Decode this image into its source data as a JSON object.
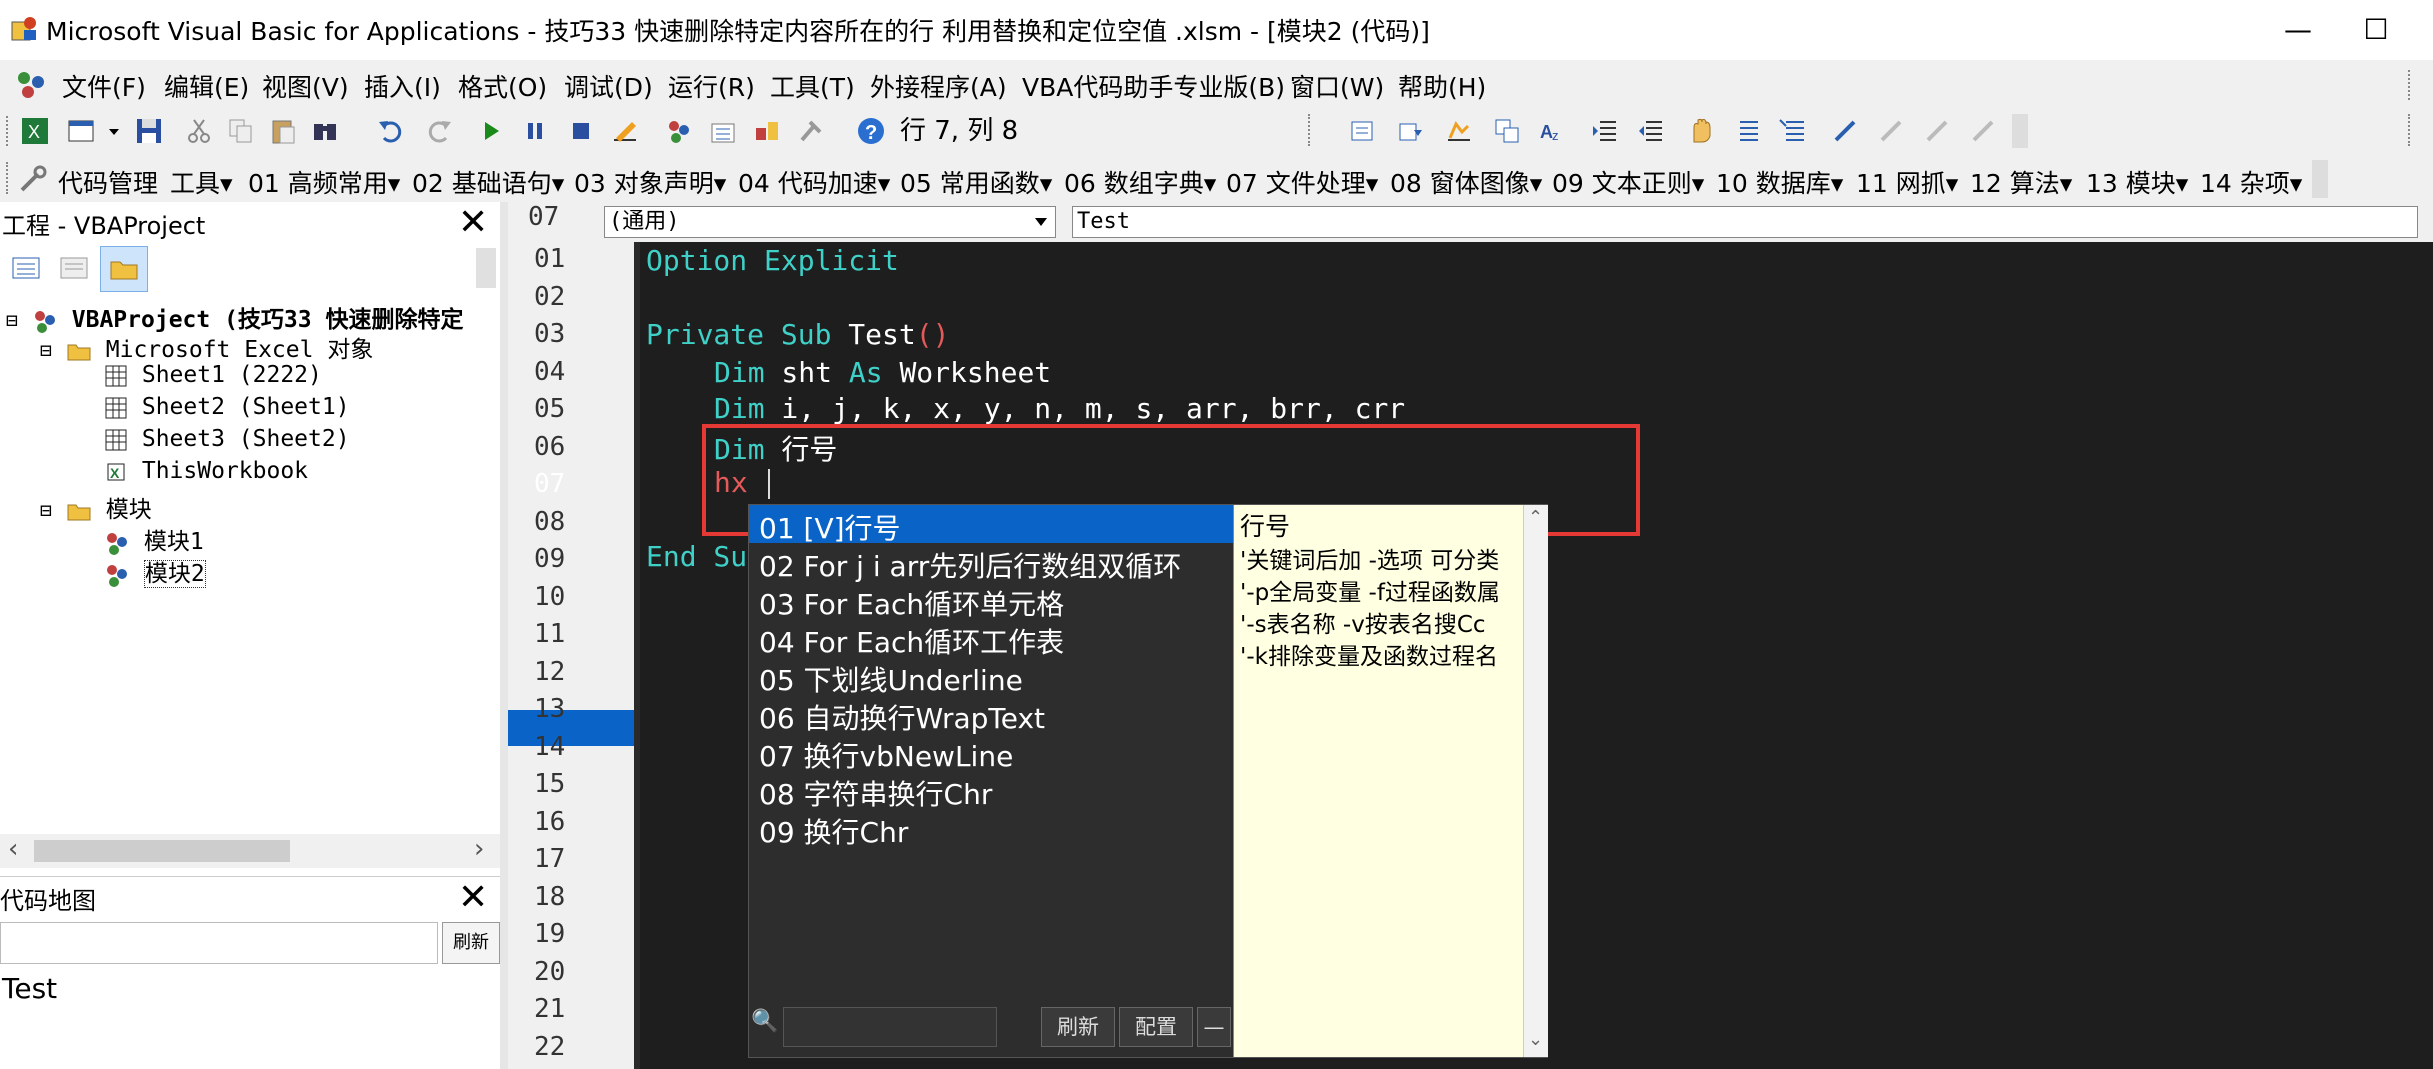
{
  "window": {
    "title": "Microsoft Visual Basic for Applications - 技巧33 快速删除特定内容所在的行 利用替换和定位空值 .xlsm - [模块2 (代码)]",
    "minimize_glyph": "—",
    "maximize_glyph": "☐"
  },
  "menu": [
    {
      "label": "文件(F)"
    },
    {
      "label": "编辑(E)"
    },
    {
      "label": "视图(V)"
    },
    {
      "label": "插入(I)"
    },
    {
      "label": "格式(O)"
    },
    {
      "label": "调试(D)"
    },
    {
      "label": "运行(R)"
    },
    {
      "label": "工具(T)"
    },
    {
      "label": "外接程序(A)"
    },
    {
      "label": "VBA代码助手专业版(B)"
    },
    {
      "label": "窗口(W)"
    },
    {
      "label": "帮助(H)"
    }
  ],
  "toolbar1": {
    "position_text": "行 7, 列 8"
  },
  "toolbar2": {
    "items": [
      "代码管理",
      "工具▾",
      "01 高频常用▾",
      "02 基础语句▾",
      "03 对象声明▾",
      "04 代码加速▾",
      "05 常用函数▾",
      "06 数组字典▾",
      "07 文件处理▾",
      "08 窗体图像▾",
      "09 文本正则▾",
      "10 数据库▾",
      "11 网抓▾",
      "12 算法▾",
      "13 模块▾",
      "14 杂项▾"
    ]
  },
  "project": {
    "title": "工程 - VBAProject",
    "close_glyph": "✕",
    "tree": [
      {
        "label": "VBAProject (技巧33 快速删除特定",
        "expander": "⊟"
      },
      {
        "label": "Microsoft Excel 对象",
        "expander": "⊟"
      },
      {
        "label": "Sheet1 (2222)"
      },
      {
        "label": "Sheet2 (Sheet1)"
      },
      {
        "label": "Sheet3 (Sheet2)"
      },
      {
        "label": "ThisWorkbook"
      },
      {
        "label": "模块",
        "expander": "⊟"
      },
      {
        "label": "模块1"
      },
      {
        "label": "模块2"
      }
    ],
    "scroll_left": "‹",
    "scroll_right": "›"
  },
  "codemap": {
    "title": "代码地图",
    "close_glyph": "✕",
    "refresh_label": "刷新",
    "items": [
      "Test"
    ]
  },
  "code": {
    "current_line": "07",
    "object_combo": "(通用)",
    "proc_combo": "Test",
    "line_numbers": [
      "01",
      "02",
      "03",
      "04",
      "05",
      "06",
      "07",
      "08",
      "09",
      "10",
      "11",
      "12",
      "13",
      "14",
      "15",
      "16",
      "17",
      "18",
      "19",
      "20",
      "21",
      "22"
    ],
    "lines": {
      "l1_kw": "Option Explicit",
      "l3_kw": "Private Sub",
      "l3_name": " Test",
      "l3_paren": "()",
      "l4_kw": "Dim",
      "l4_mid": " sht ",
      "l4_kw2": "As",
      "l4_type": " Worksheet",
      "l5_kw": "Dim",
      "l5_rest": " i, j, k, x, y, n, m, s, arr, brr, crr",
      "l6_kw": "Dim",
      "l6_rest": " 行号",
      "l7_text": "hx",
      "l9_text": "End Su"
    }
  },
  "popup": {
    "items": [
      "01 [V]行号",
      "02 For j i arr先列后行数组双循环",
      "03 For Each循环单元格",
      "04 For Each循环工作表",
      "05 下划线Underline",
      "06 自动换行WrapText",
      "07 换行vbNewLine",
      "08 字符串换行Chr",
      "09 换行Chr"
    ],
    "desc_lines": [
      "行号",
      "'关键词后加 -选项 可分类",
      "'-p全局变量 -f过程函数属",
      "'-s表名称   -v按表名搜Cc",
      "'-k排除变量及函数过程名"
    ],
    "search_icon": "🔍",
    "refresh_label": "刷新",
    "config_label": "配置",
    "dash_label": "—",
    "scroll_up": "⌃",
    "scroll_down": "⌄"
  },
  "colors": {
    "code_bg": "#1e1e1e",
    "keyword": "#3fd0c8",
    "highlight_border": "#e53935",
    "selection": "#0a64c8",
    "tooltip_bg": "#ffffe1"
  }
}
